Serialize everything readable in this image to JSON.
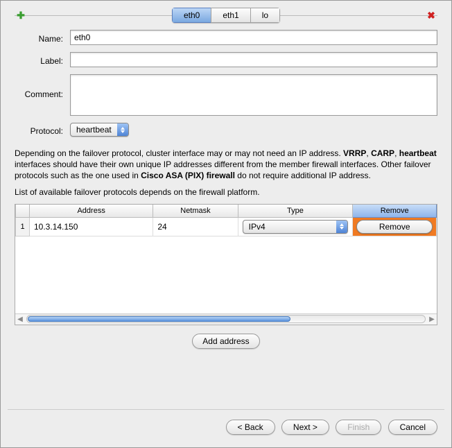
{
  "tabs": {
    "items": [
      "eth0",
      "eth1",
      "lo"
    ],
    "activeIndex": 0
  },
  "form": {
    "name_label": "Name:",
    "name_value": "eth0",
    "label_label": "Label:",
    "label_value": "",
    "comment_label": "Comment:",
    "comment_value": "",
    "protocol_label": "Protocol:",
    "protocol_value": "heartbeat"
  },
  "info": {
    "p1_a": "Depending on the failover protocol, cluster interface may or may not need an IP address. ",
    "b1": "VRRP",
    "p1_b": ", ",
    "b2": "CARP",
    "p1_c": ", ",
    "b3": "heartbeat",
    "p1_d": " interfaces should have their own unique IP addresses different from the member firewall interfaces. Other failover protocols such as the one used in ",
    "b4": "Cisco ASA (PIX) firewall",
    "p1_e": " do not require additional IP address.",
    "p2": "List of available failover protocols depends on the firewall platform."
  },
  "table": {
    "headers": {
      "address": "Address",
      "netmask": "Netmask",
      "type": "Type",
      "remove": "Remove"
    },
    "rows": [
      {
        "num": "1",
        "address": "10.3.14.150",
        "netmask": "24",
        "type": "IPv4",
        "remove_label": "Remove"
      }
    ]
  },
  "buttons": {
    "add_address": "Add address",
    "back": "< Back",
    "next": "Next >",
    "finish": "Finish",
    "cancel": "Cancel"
  }
}
